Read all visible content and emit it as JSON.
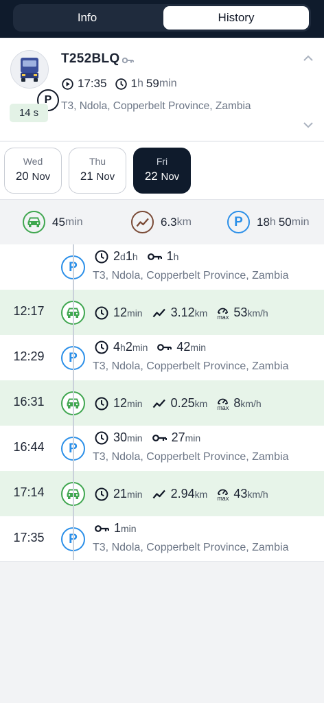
{
  "tabs": {
    "info": "Info",
    "history": "History"
  },
  "vehicle": {
    "plate": "T252BLQ",
    "status_letter": "P",
    "start_time": "17:35",
    "duration_h": "1",
    "duration_h_unit": "h",
    "duration_m": "59",
    "duration_m_unit": "min",
    "address": "T3, Ndola, Copperbelt Province, Zambia",
    "age": "14 s"
  },
  "days": [
    {
      "name": "Wed",
      "day": "20",
      "month": "Nov",
      "selected": false
    },
    {
      "name": "Thu",
      "day": "21",
      "month": "Nov",
      "selected": false
    },
    {
      "name": "Fri",
      "day": "22",
      "month": "Nov",
      "selected": true
    }
  ],
  "summary": {
    "drive_value": "45",
    "drive_unit": "min",
    "distance_value": "6.3",
    "distance_unit": "km",
    "park_h": "18",
    "park_h_unit": "h",
    "park_m": "50",
    "park_m_unit": "min",
    "park_letter": "P"
  },
  "timeline": [
    {
      "type": "park",
      "time": "",
      "letter": "P",
      "dur": "2",
      "dur_u1": "d",
      "dur2": " 1",
      "dur_u2": "h",
      "ign": "1",
      "ign_u": "h",
      "addr": "T3, Ndola, Copperbelt Province, Zambia"
    },
    {
      "type": "drive",
      "time": "12:17",
      "dur": "12",
      "dur_u": "min",
      "dist": "3.12",
      "dist_u": "km",
      "speed": "53",
      "speed_u": "km/h",
      "max_label": "max"
    },
    {
      "type": "park",
      "time": "12:29",
      "letter": "P",
      "dur": "4",
      "dur_u1": "h",
      "dur2": " 2",
      "dur_u2": "min",
      "ign": "42",
      "ign_u": "min",
      "addr": "T3, Ndola, Copperbelt Province, Zambia"
    },
    {
      "type": "drive",
      "time": "16:31",
      "dur": "12",
      "dur_u": "min",
      "dist": "0.25",
      "dist_u": "km",
      "speed": "8",
      "speed_u": "km/h",
      "max_label": "max"
    },
    {
      "type": "park",
      "time": "16:44",
      "letter": "P",
      "dur": "30",
      "dur_u1": "min",
      "dur2": "",
      "dur_u2": "",
      "ign": "27",
      "ign_u": "min",
      "addr": "T3, Ndola, Copperbelt Province, Zambia"
    },
    {
      "type": "drive",
      "time": "17:14",
      "dur": "21",
      "dur_u": "min",
      "dist": "2.94",
      "dist_u": "km",
      "speed": "43",
      "speed_u": "km/h",
      "max_label": "max"
    },
    {
      "type": "park_ign",
      "time": "17:35",
      "letter": "P",
      "ign": "1",
      "ign_u": "min",
      "addr": "T3, Ndola, Copperbelt Province, Zambia"
    }
  ],
  "colors": {
    "header": "#0f1b2c",
    "park_blue": "#2b8fe8",
    "drive_green": "#3fa64f",
    "distance_brown": "#7a4a36",
    "drive_row_bg": "#e7f4e9"
  }
}
